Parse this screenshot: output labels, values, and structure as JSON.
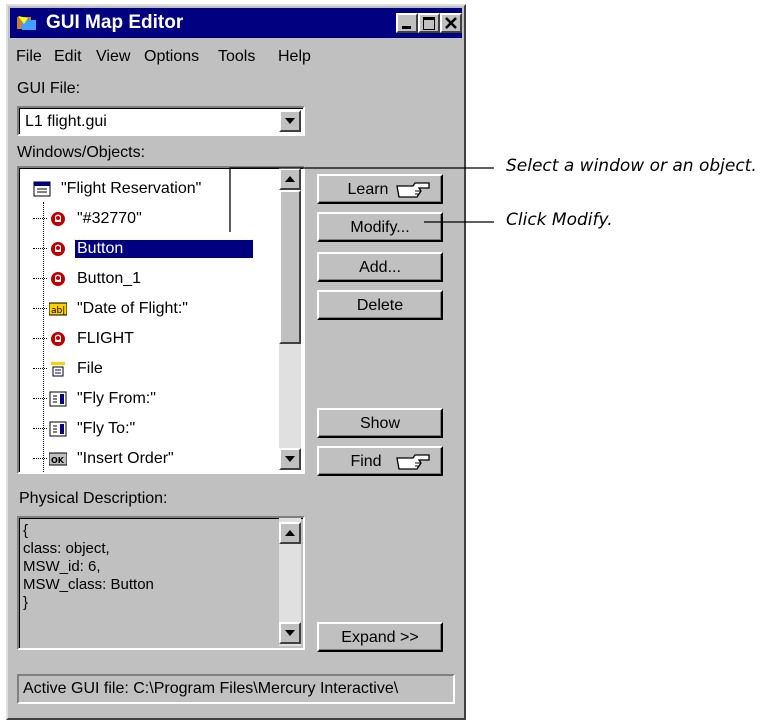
{
  "window": {
    "title": "GUI Map Editor",
    "menu": [
      "File",
      "Edit",
      "View",
      "Options",
      "Tools",
      "Help"
    ]
  },
  "gui_file": {
    "label": "GUI File:",
    "value": "L1  flight.gui"
  },
  "objects": {
    "label": "Windows/Objects:",
    "items": [
      {
        "label": "\"Flight Reservation\"",
        "icon": "window-icon"
      },
      {
        "label": "\"#32770\"",
        "icon": "object-icon"
      },
      {
        "label": "Button",
        "icon": "object-icon",
        "selected": true
      },
      {
        "label": "Button_1",
        "icon": "object-icon"
      },
      {
        "label": "\"Date of Flight:\"",
        "icon": "edit-field-icon"
      },
      {
        "label": "FLIGHT",
        "icon": "object-icon"
      },
      {
        "label": "File",
        "icon": "menu-icon"
      },
      {
        "label": "\"Fly From:\"",
        "icon": "list-icon"
      },
      {
        "label": "\"Fly To:\"",
        "icon": "list-icon"
      },
      {
        "label": "\"Insert Order\"",
        "icon": "push-button-icon"
      }
    ]
  },
  "buttons": {
    "learn": "Learn",
    "modify": "Modify...",
    "add": "Add...",
    "delete": "Delete",
    "show": "Show",
    "find": "Find",
    "expand": "Expand >>"
  },
  "physical": {
    "label": "Physical Description:",
    "lines": [
      "{",
      "class: object,",
      "MSW_id: 6,",
      "MSW_class: Button",
      "}"
    ]
  },
  "status": "Active GUI file: C:\\Program Files\\Mercury Interactive\\",
  "annotations": {
    "select": "Select a window or an object.",
    "modify": "Click Modify."
  }
}
